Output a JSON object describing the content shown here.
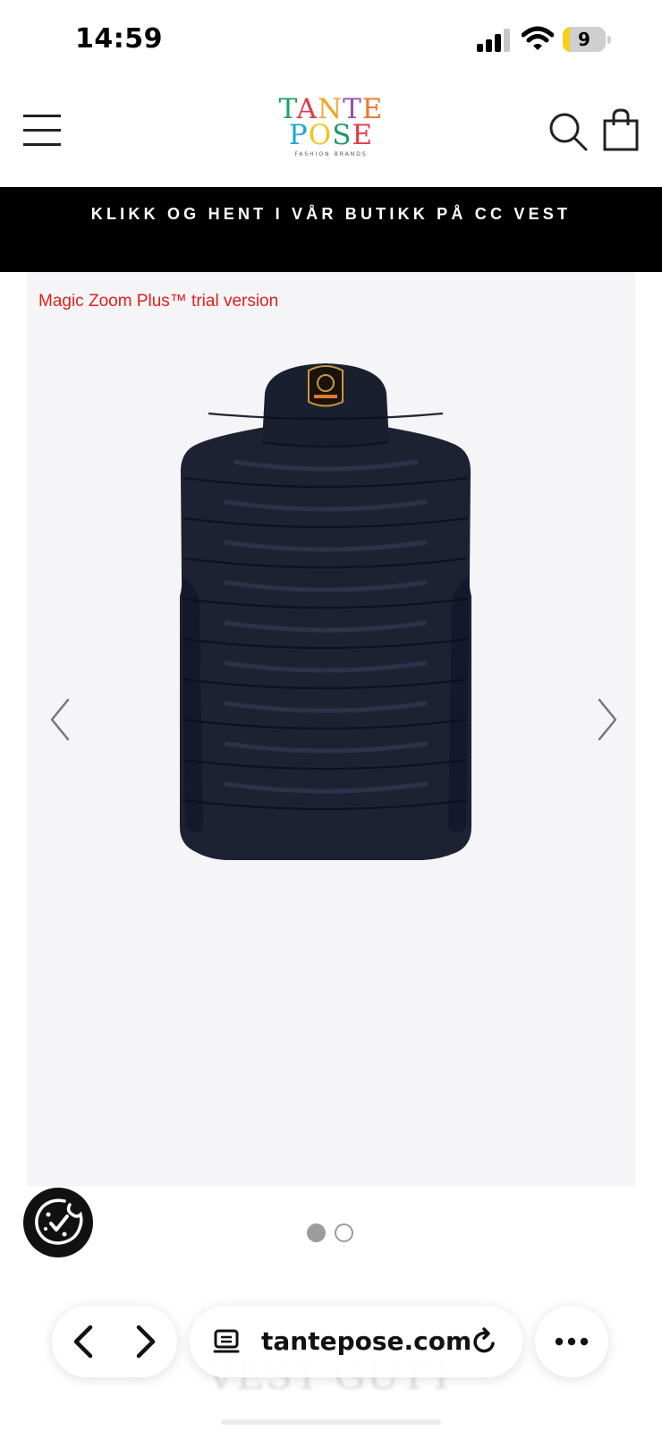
{
  "status_bar": {
    "time": "14:59",
    "battery_level": "9",
    "battery_fraction": 0.09
  },
  "header": {
    "logo": {
      "line1": "TANTE",
      "line2": "POSE",
      "tagline": "FASHION BRANDS"
    },
    "icons": {
      "menu": "hamburger-menu-icon",
      "search": "search-icon",
      "cart": "shopping-bag-icon"
    }
  },
  "announcement": {
    "text": "KLIKK OG HENT I VÅR BUTIKK PÅ CC VEST"
  },
  "gallery": {
    "trial_notice": "Magic Zoom Plus™ trial version",
    "image_alt": "Navy quilted puffer vest, back view",
    "slide_count": 2,
    "active_slide": 1
  },
  "product": {
    "faded_title": "VEST GUTT"
  },
  "browser_toolbar": {
    "url": "tantepose.com"
  },
  "colors": {
    "announcement_bg": "#000000",
    "gallery_bg": "#f5f5f8",
    "trial_text": "#e0201a",
    "vest": "#1d2233",
    "logo_letters": [
      "#1ca362",
      "#e23b4b",
      "#f1a52a",
      "#8f53a8",
      "#e8792e",
      "#1fa6d8",
      "#f0c419",
      "#1c9c6a",
      "#e23b4b"
    ]
  }
}
